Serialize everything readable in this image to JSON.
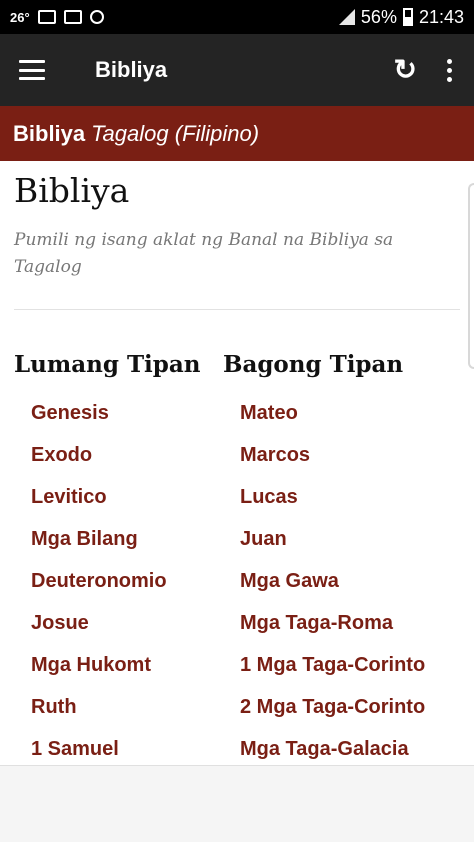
{
  "status_bar": {
    "temperature": "26°",
    "battery_percent": "56%",
    "time": "21:43"
  },
  "app_bar": {
    "title": "Bibliya"
  },
  "banner": {
    "bold": "Bibliya",
    "italic": "Tagalog (Filipino)"
  },
  "page": {
    "title": "Bibliya",
    "subtitle": "Pumili ng isang aklat ng Banal na Bibliya sa Tagalog"
  },
  "old_testament": {
    "heading": "Lumang Tipan",
    "books": [
      "Genesis",
      "Exodo",
      "Levitico",
      "Mga Bilang",
      "Deuteronomio",
      "Josue",
      "Mga Hukomt",
      "Ruth",
      "1 Samuel"
    ]
  },
  "new_testament": {
    "heading": "Bagong Tipan",
    "books": [
      "Mateo",
      "Marcos",
      "Lucas",
      "Juan",
      "Mga Gawa",
      "Mga Taga-Roma",
      "1 Mga Taga-Corinto",
      "2 Mga Taga-Corinto",
      "Mga Taga-Galacia"
    ]
  },
  "colors": {
    "accent": "#7a1f14",
    "app_bar": "#242424"
  }
}
